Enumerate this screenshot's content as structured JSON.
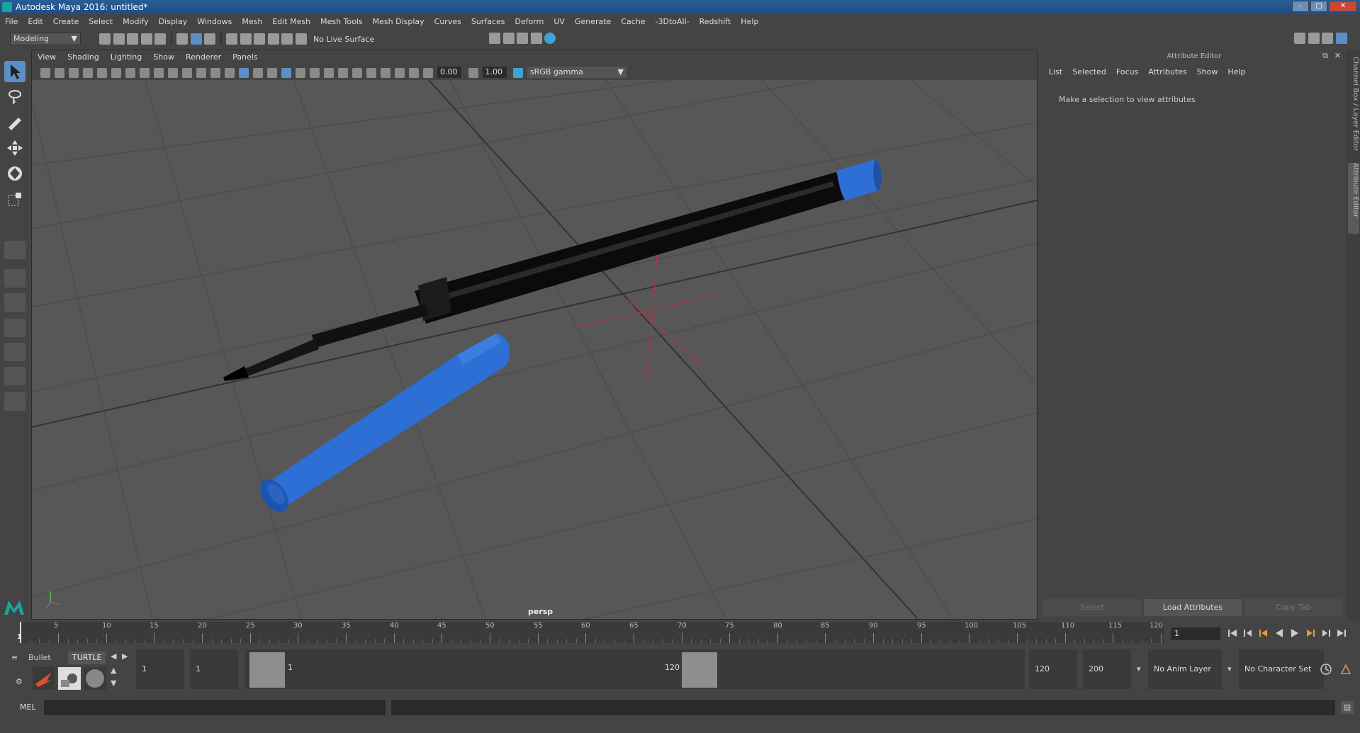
{
  "window": {
    "title": "Autodesk Maya 2016: untitled*"
  },
  "menubar": {
    "items": [
      "File",
      "Edit",
      "Create",
      "Select",
      "Modify",
      "Display",
      "Windows",
      "Mesh",
      "Edit Mesh",
      "Mesh Tools",
      "Mesh Display",
      "Curves",
      "Surfaces",
      "Deform",
      "UV",
      "Generate",
      "Cache",
      "-3DtoAll-",
      "Redshift",
      "Help"
    ]
  },
  "status_line": {
    "mode": "Modeling",
    "live_surface": "No Live Surface"
  },
  "panel": {
    "menu": [
      "View",
      "Shading",
      "Lighting",
      "Show",
      "Renderer",
      "Panels"
    ],
    "exposure": "0.00",
    "gamma": "1.00",
    "color_space": "sRGB gamma",
    "camera_label": "persp"
  },
  "attribute_editor": {
    "title": "Attribute Editor",
    "menu": [
      "List",
      "Selected",
      "Focus",
      "Attributes",
      "Show",
      "Help"
    ],
    "message": "Make a selection to view attributes",
    "buttons": {
      "select": "Select",
      "load": "Load Attributes",
      "copy": "Copy Tab"
    }
  },
  "side_tabs": {
    "channel_box": "Channel Box / Layer Editor",
    "attribute_editor": "Attribute Editor"
  },
  "time_slider": {
    "ticks": [
      "5",
      "10",
      "15",
      "20",
      "25",
      "30",
      "35",
      "40",
      "45",
      "50",
      "55",
      "60",
      "65",
      "70",
      "75",
      "80",
      "85",
      "90",
      "95",
      "100",
      "105",
      "110",
      "115",
      "120"
    ],
    "start_label": "1",
    "current_frame": "1"
  },
  "range_slider": {
    "start": "1",
    "playback_start": "1",
    "range_start_label": "1",
    "range_end_label": "120",
    "playback_end": "120",
    "end": "200",
    "anim_layer": "No Anim Layer",
    "character_set": "No Character Set"
  },
  "shelf_tabs": {
    "tab1": "Bullet",
    "tab2": "TURTLE"
  },
  "command_line": {
    "label": "MEL"
  },
  "colors": {
    "viewport_bg": "#575757",
    "pen_blue": "#2e6fd6",
    "pen_black": "#0b0b0b"
  }
}
